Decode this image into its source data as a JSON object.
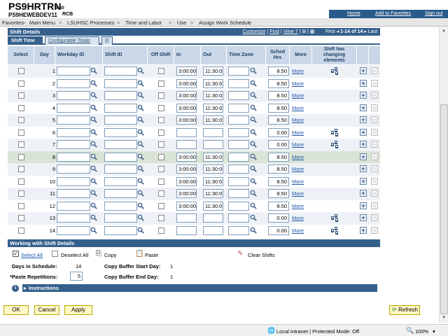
{
  "header": {
    "app_title": "PS9HRTRN",
    "version": "8.50",
    "database": "PS9HEWEBDEV11",
    "user": "RCB",
    "links": [
      "Home",
      "Add to Favorites",
      "Sign out"
    ]
  },
  "nav": {
    "items": [
      "Favorites",
      "Main Menu",
      "LSUHSC Processes",
      "Time and Labor",
      "Use",
      "Assign Work Schedule"
    ],
    "separator": ">"
  },
  "shift_details": {
    "title": "Shift Details",
    "customize": "Customize",
    "find": "Find",
    "view": "View 7",
    "first": "First",
    "range": "1-14 of 14",
    "last": "Last",
    "tabs": [
      "Shift Time",
      "Configurable Totals",
      "|||"
    ]
  },
  "columns": [
    "Select",
    "Day",
    "Workday ID",
    "Shift ID",
    "Off Shift",
    "In",
    "Out",
    "Time Zone",
    "Sched Hrs",
    "More",
    "Shift has changing elements"
  ],
  "rows": [
    {
      "day": "1",
      "in": "3:00:00",
      "out": "11:30:0",
      "hrs": "8.50",
      "more": "More",
      "changing": true
    },
    {
      "day": "2",
      "in": "3:00:00",
      "out": "11:30:0",
      "hrs": "8.50",
      "more": "More",
      "changing": false
    },
    {
      "day": "3",
      "in": "3:00:00",
      "out": "11:30:0",
      "hrs": "8.50",
      "more": "More",
      "changing": false
    },
    {
      "day": "4",
      "in": "3:00:00",
      "out": "11:30:0",
      "hrs": "8.50",
      "more": "More",
      "changing": false
    },
    {
      "day": "5",
      "in": "3:00:00",
      "out": "11:30:0",
      "hrs": "8.50",
      "more": "More",
      "changing": false
    },
    {
      "day": "6",
      "in": "",
      "out": "",
      "hrs": "0.00",
      "more": "More",
      "changing": true
    },
    {
      "day": "7",
      "in": "",
      "out": "",
      "hrs": "0.00",
      "more": "More",
      "changing": true
    },
    {
      "day": "8",
      "in": "3:00:00",
      "out": "11:30:0",
      "hrs": "8.50",
      "more": "More",
      "changing": false
    },
    {
      "day": "9",
      "in": "3:00:00",
      "out": "11:30:0",
      "hrs": "8.50",
      "more": "More",
      "changing": false
    },
    {
      "day": "10",
      "in": "3:00:00",
      "out": "11:30:0",
      "hrs": "8.50",
      "more": "More",
      "changing": false
    },
    {
      "day": "11",
      "in": "3:00:00",
      "out": "11:30:0",
      "hrs": "8.50",
      "more": "More",
      "changing": false
    },
    {
      "day": "12",
      "in": "3:00:00",
      "out": "11:30:0",
      "hrs": "8.50",
      "more": "More",
      "changing": false
    },
    {
      "day": "13",
      "in": "",
      "out": "",
      "hrs": "0.00",
      "more": "More",
      "changing": true
    },
    {
      "day": "14",
      "in": "",
      "out": "",
      "hrs": "0.00",
      "more": "More",
      "changing": true
    }
  ],
  "working": {
    "title": "Working with Shift Details",
    "select_all": "Select All",
    "deselect_all": "Deselect All",
    "copy": "Copy",
    "paste": "Paste",
    "clear_shifts": "Clear Shifts",
    "days_label": "Days in Schedule:",
    "days_value": "14",
    "paste_rep_label": "*Paste Repetitions:",
    "paste_rep_value": "5",
    "copy_start_label": "Copy Buffer Start Day:",
    "copy_start_value": "1",
    "copy_end_label": "Copy Buffer End Day:",
    "copy_end_value": "1",
    "instructions": "Instructions"
  },
  "buttons": {
    "ok": "OK",
    "cancel": "Cancel",
    "apply": "Apply",
    "refresh": "Refresh"
  },
  "status": {
    "zone": "Local intranet | Protected Mode: Off",
    "zoom": "100%"
  },
  "colors": {
    "header_bar": "#35608c",
    "grid_header": "#c9d7e8",
    "button": "#fff8c4",
    "link": "#2255aa"
  }
}
